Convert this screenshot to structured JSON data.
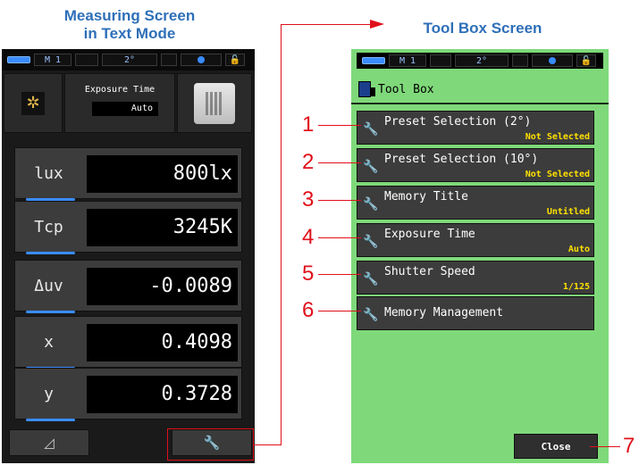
{
  "left_caption": {
    "line1": "Measuring Screen",
    "line2": "in Text Mode"
  },
  "right_caption": "Tool Box Screen",
  "status_bar": {
    "mode": "M  1",
    "angle": "2°"
  },
  "measuring": {
    "exposure_title": "Exposure Time",
    "exposure_value": "Auto",
    "rows": [
      {
        "label": "lux",
        "value": "800lx"
      },
      {
        "label": "Tcp",
        "value": "3245K"
      },
      {
        "label": "Δuv",
        "value": "-0.0089"
      },
      {
        "label": "x",
        "value": "0.4098"
      },
      {
        "label": "y",
        "value": "0.3728"
      }
    ],
    "footer_left_icon": "delta-icon",
    "footer_right_icon": "wrench-icon"
  },
  "toolbox": {
    "title": "Tool Box",
    "items": [
      {
        "num": "1",
        "name": "Preset Selection (2°)",
        "sub": "Not Selected"
      },
      {
        "num": "2",
        "name": "Preset Selection (10°)",
        "sub": "Not Selected"
      },
      {
        "num": "3",
        "name": "Memory Title",
        "sub": "Untitled"
      },
      {
        "num": "4",
        "name": "Exposure Time",
        "sub": "Auto"
      },
      {
        "num": "5",
        "name": "Shutter Speed",
        "sub": "1/125"
      },
      {
        "num": "6",
        "name": "Memory Management",
        "sub": ""
      }
    ],
    "close_label": "Close",
    "close_num": "7"
  },
  "colors": {
    "accent_blue": "#2e6fb8",
    "annotation_red": "#e0101b",
    "toolbox_bg": "#7fd97a"
  }
}
